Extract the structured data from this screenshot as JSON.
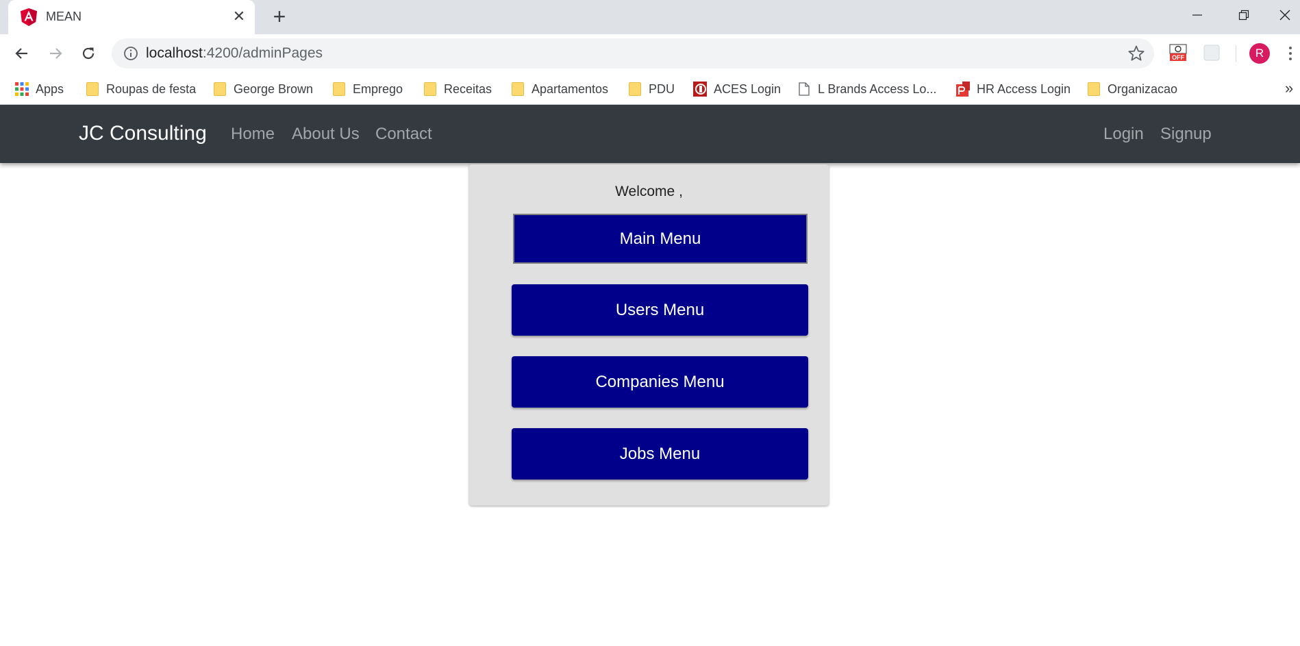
{
  "browser": {
    "tab_title": "MEAN",
    "url_host": "localhost",
    "url_path": ":4200/adminPages",
    "profile_initial": "R",
    "bookmarks": [
      {
        "label": "Apps",
        "icon": "apps-grid-icon"
      },
      {
        "label": "Roupas de festa",
        "icon": "folder-icon"
      },
      {
        "label": "George Brown",
        "icon": "folder-icon"
      },
      {
        "label": "Emprego",
        "icon": "folder-icon"
      },
      {
        "label": "Receitas",
        "icon": "folder-icon"
      },
      {
        "label": "Apartamentos",
        "icon": "folder-icon"
      },
      {
        "label": "PDU",
        "icon": "folder-icon"
      },
      {
        "label": "ACES Login",
        "icon": "aces-favicon-icon"
      },
      {
        "label": "L Brands Access Lo...",
        "icon": "page-icon"
      },
      {
        "label": "HR Access Login",
        "icon": "hr-favicon-icon"
      },
      {
        "label": "Organizacao",
        "icon": "folder-icon"
      }
    ],
    "bookmarks_overflow": "»"
  },
  "navbar": {
    "brand": "JC Consulting",
    "left_links": [
      "Home",
      "About Us",
      "Contact"
    ],
    "right_links": [
      "Login",
      "Signup"
    ],
    "background": "#343a40"
  },
  "admin_panel": {
    "welcome": "Welcome ,",
    "buttons": [
      "Main Menu",
      "Users Menu",
      "Companies Menu",
      "Jobs Menu"
    ],
    "button_color": "#00008b"
  }
}
